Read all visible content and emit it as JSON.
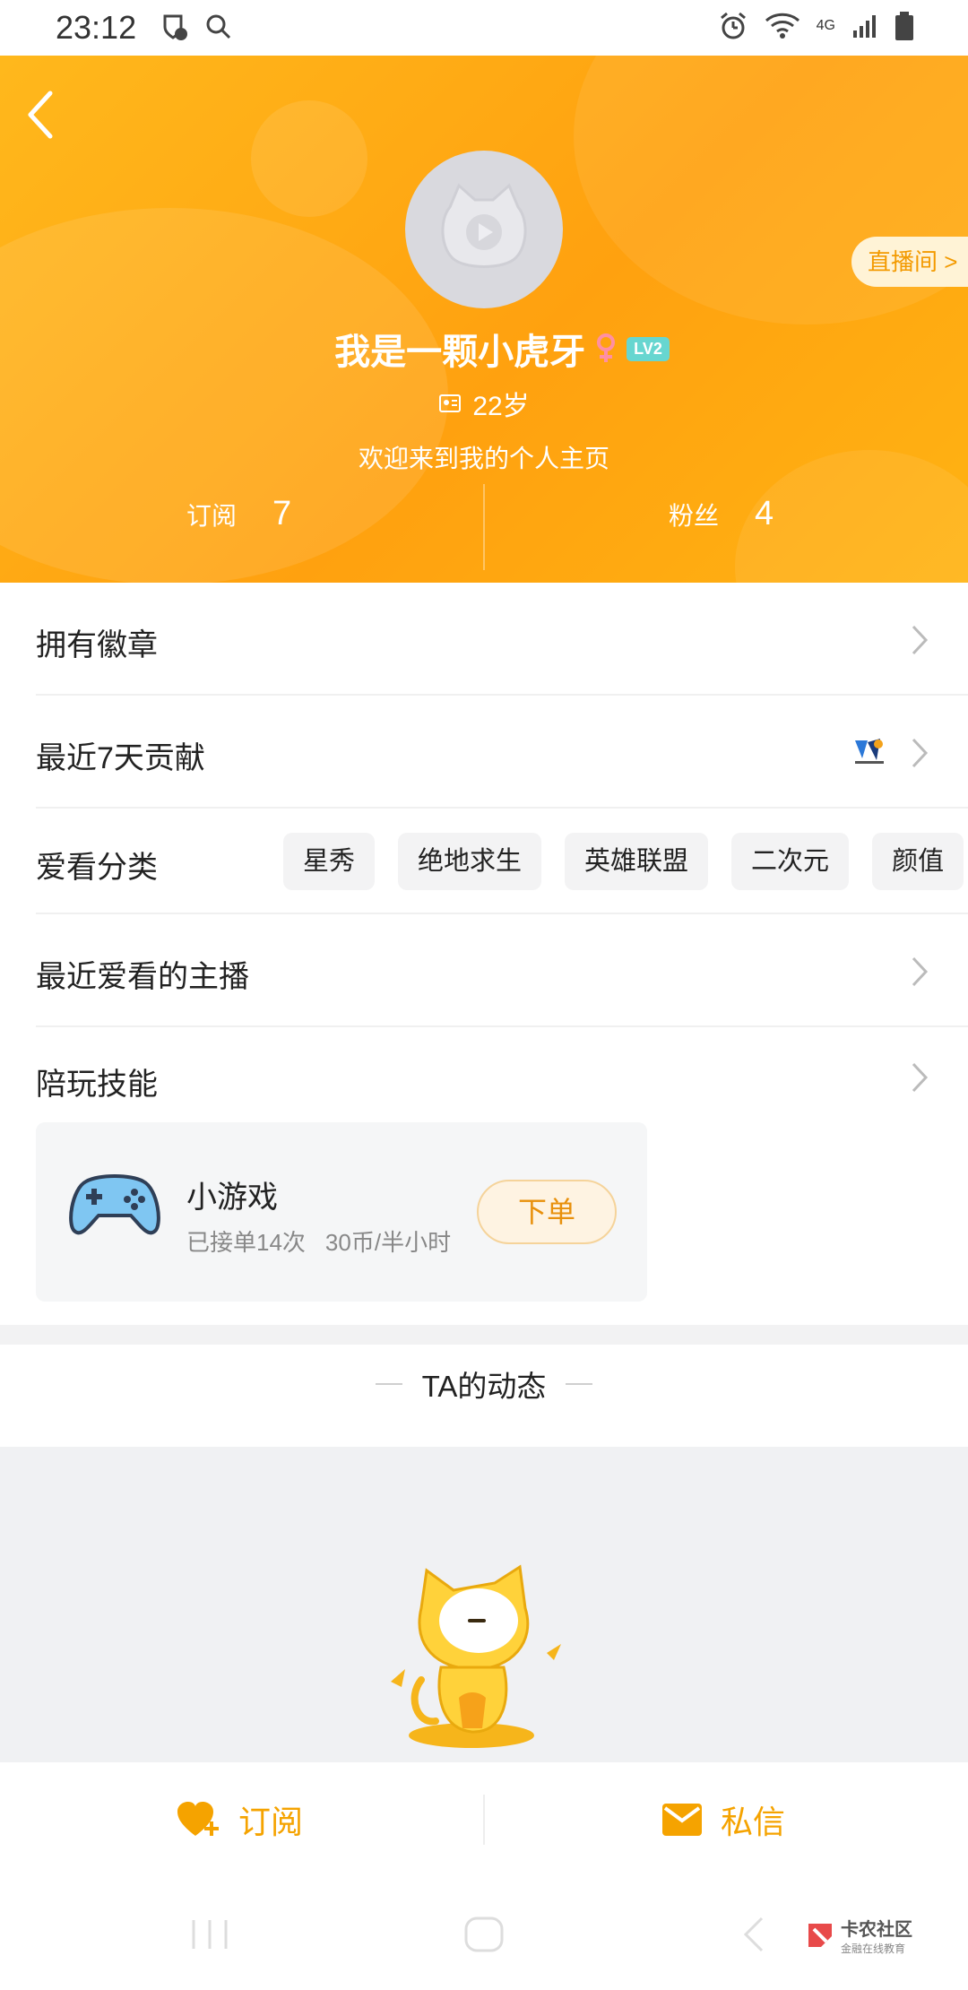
{
  "status_bar": {
    "time": "23:12",
    "network": "4G",
    "icons": [
      "shield-icon",
      "search-icon",
      "alarm-icon",
      "wifi-icon",
      "signal-icon",
      "battery-icon"
    ]
  },
  "profile": {
    "username": "我是一颗小虎牙",
    "level": "LV2",
    "gender_icon": "female-icon",
    "age": "22岁",
    "bio": "欢迎来到我的个人主页",
    "live_room_label": "直播间 >",
    "stats": {
      "subscribe_label": "订阅",
      "subscribe_count": "7",
      "fans_label": "粉丝",
      "fans_count": "4"
    }
  },
  "sections": {
    "badges": "拥有徽章",
    "contribution": "最近7天贡献",
    "categories": {
      "title": "爱看分类",
      "tags": [
        "星秀",
        "绝地求生",
        "英雄联盟",
        "二次元",
        "颜值"
      ]
    },
    "recent_anchors": "最近爱看的主播",
    "skills": "陪玩技能"
  },
  "skill_card": {
    "name": "小游戏",
    "orders": "已接单14次",
    "price": "30币/半小时",
    "order_button": "下单"
  },
  "feed": {
    "title": "TA的动态"
  },
  "bottom_actions": {
    "subscribe": "订阅",
    "message": "私信"
  },
  "watermark": {
    "title": "卡农社区",
    "subtitle": "金融在线教育"
  },
  "colors": {
    "header_orange": "#ffa10f",
    "accent": "#f5a300",
    "level_badge": "#67d6d0"
  }
}
